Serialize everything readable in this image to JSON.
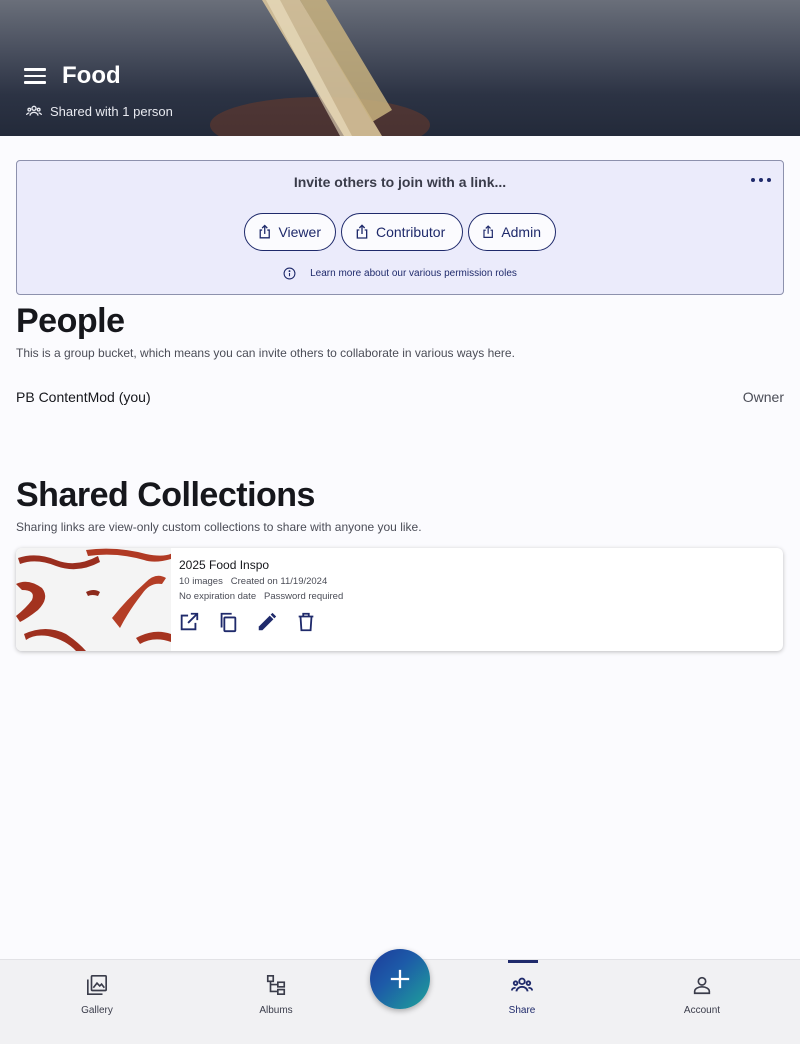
{
  "header": {
    "title": "Food",
    "shared_text": "Shared with 1 person"
  },
  "invite": {
    "title": "Invite others to join with a link...",
    "roles": [
      "Viewer",
      "Contributor",
      "Admin"
    ],
    "learn_more": "Learn more about our various permission roles"
  },
  "people": {
    "heading": "People",
    "description": "This is a group bucket, which means you can invite others to collaborate in various ways here.",
    "members": [
      {
        "name": "PB ContentMod (you)",
        "role": "Owner"
      }
    ]
  },
  "shared_collections": {
    "heading": "Shared Collections",
    "description": "Sharing links are view-only custom collections to share with anyone you like.",
    "items": [
      {
        "title": "2025 Food Inspo",
        "image_count": "10 images",
        "created": "Created on 11/19/2024",
        "expiration": "No expiration date",
        "password": "Password required",
        "actions": [
          "open-external-icon",
          "copy-icon",
          "edit-icon",
          "delete-icon"
        ]
      }
    ]
  },
  "bottom_nav": {
    "items": [
      {
        "label": "Gallery",
        "icon": "gallery-icon",
        "active": false
      },
      {
        "label": "Albums",
        "icon": "albums-icon",
        "active": false
      },
      {
        "label": "Share",
        "icon": "share-people-icon",
        "active": true
      },
      {
        "label": "Account",
        "icon": "account-icon",
        "active": false
      }
    ],
    "fab_icon": "plus-icon"
  },
  "colors": {
    "accent": "#1f2a6b",
    "invite_bg": "#ebebfb",
    "header_dark": "#232a3a"
  }
}
